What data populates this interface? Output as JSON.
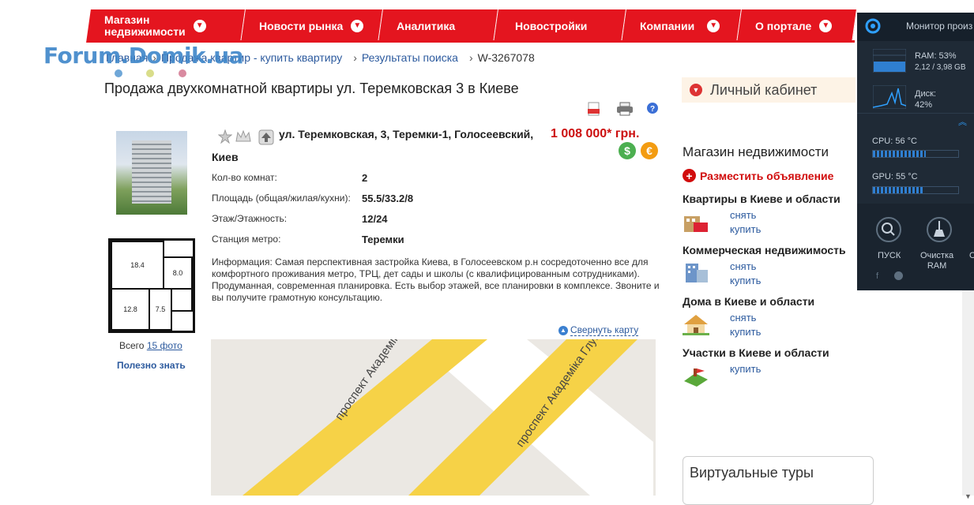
{
  "nav": {
    "items": [
      {
        "label": "Магазин\nнедвижимости",
        "has_dropdown": true
      },
      {
        "label": "Новости рынка",
        "has_dropdown": true
      },
      {
        "label": "Аналитика",
        "has_dropdown": false
      },
      {
        "label": "Новостройки",
        "has_dropdown": false
      },
      {
        "label": "Компании",
        "has_dropdown": true
      },
      {
        "label": "О портале",
        "has_dropdown": true
      }
    ],
    "accent": "#e4151f"
  },
  "logo": {
    "text": "Forum.Domik.ua"
  },
  "breadcrumbs": {
    "home": "Главная",
    "sale": "Продажа квартир - купить квартиру",
    "results": "Результаты поиска",
    "current": "W-3267078",
    "sep": "›"
  },
  "page_title": "Продажа двухкомнатной квартиры ул. Теремковская 3 в Киеве",
  "listing": {
    "address_line1": "ул. Теремковская, 3, Теремки-1, Голосеевский,",
    "address_line2": "Киев",
    "price": "1 008 000* грн.",
    "currency_usd": "$",
    "currency_eur": "€",
    "properties": [
      {
        "label": "Кол-во комнат:",
        "value": "2"
      },
      {
        "label": "Площадь (общая/жилая/кухни):",
        "value": "55.5/33.2/8"
      },
      {
        "label": "Этаж/Этажность:",
        "value": "12/24"
      },
      {
        "label": "Станция метро:",
        "value": "Теремки"
      }
    ],
    "info": "Информация: Самая перспективная застройка Киева, в Голосеевском р.н сосредоточенно все для комфортного проживания метро, ТРЦ, дет сады и школы (с квалифицированным сотрудниками). Продуманная, современная планировка. Есть выбор этажей, все планировки в комплексе. Звоните и вы получите грамотную консультацию.",
    "plan_rooms": [
      "18.4",
      "8.0",
      "12.8",
      "7.5"
    ],
    "photos_prefix": "Всего",
    "photos_link": "15 фото",
    "useful": "Полезно знать",
    "collapse_map": "Свернуть карту",
    "map_street": "проспект Академіка Глушкова"
  },
  "sidebar": {
    "cabinet": "Личный кабинет",
    "shop_title": "Магазин недвижимости",
    "add_ad": "Разместить объявление",
    "sections": [
      {
        "title": "Квартиры в Киеве и области",
        "links": [
          "снять",
          "купить"
        ],
        "icon": "apartment-icon"
      },
      {
        "title": "Коммерческая недвижимость",
        "links": [
          "снять",
          "купить"
        ],
        "icon": "office-icon"
      },
      {
        "title": "Дома в Киеве и области",
        "links": [
          "снять",
          "купить"
        ],
        "icon": "house-icon"
      },
      {
        "title": "Участки в Киеве и области",
        "links": [
          "купить"
        ],
        "icon": "land-icon"
      }
    ],
    "virtual_tours": "Виртуальные туры"
  },
  "monitor": {
    "title": "Монитор произ",
    "ram": "RAM: 53%",
    "ram_detail": "2,12 / 3,98 GB",
    "disk": "Диск:",
    "disk_val": "42%",
    "cpu": "CPU:  56 °C",
    "gpu": "GPU:  55 °C",
    "cpu_level": 0.62,
    "gpu_level": 0.6,
    "btn_start": "ПУСК",
    "btn_clean": "Очистка\nRAM",
    "btn_c": "С"
  }
}
